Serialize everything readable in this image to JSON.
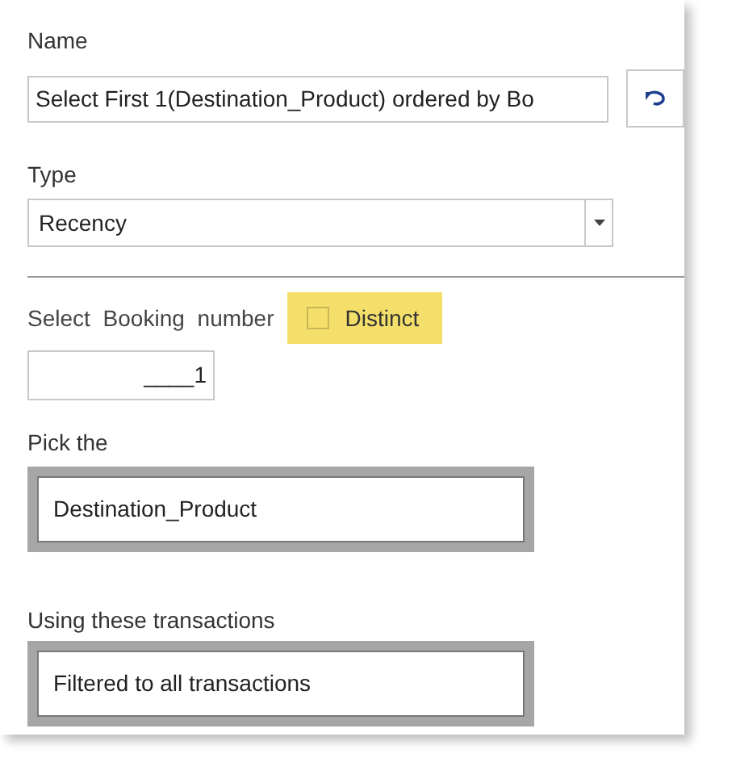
{
  "name": {
    "label": "Name",
    "value": "Select First 1(Destination_Product) ordered by Bo"
  },
  "type": {
    "label": "Type",
    "value": "Recency"
  },
  "select": {
    "label": "Select Booking number",
    "distinct": {
      "label": "Distinct",
      "checked": false
    },
    "count": "____1"
  },
  "pick": {
    "label": "Pick the",
    "value": "Destination_Product"
  },
  "transactions": {
    "label": "Using these transactions",
    "value": "Filtered to all transactions"
  }
}
